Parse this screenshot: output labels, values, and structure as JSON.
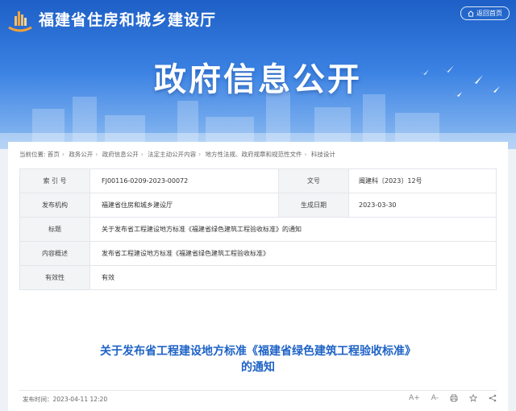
{
  "header": {
    "site_title": "福建省住房和城乡建设厅",
    "home_button": "返回首页",
    "banner_title": "政府信息公开"
  },
  "breadcrumb": {
    "label": "当前位置:",
    "items": [
      "首页",
      "政务公开",
      "政府信息公开",
      "法定主动公开内容",
      "地方性法规、政府规章和规范性文件",
      "科技设计"
    ]
  },
  "meta": {
    "index_label": "索 引 号",
    "index_value": "FJ00116-0209-2023-00072",
    "doc_no_label": "文号",
    "doc_no_value": "闽建科〔2023〕12号",
    "issuer_label": "发布机构",
    "issuer_value": "福建省住房和城乡建设厅",
    "date_label": "生成日期",
    "date_value": "2023-03-30",
    "title_label": "标题",
    "title_value": "关于发布省工程建设地方标准《福建省绿色建筑工程验收标准》的通知",
    "summary_label": "内容概述",
    "summary_value": "发布省工程建设地方标准《福建省绿色建筑工程验收标准》",
    "validity_label": "有效性",
    "validity_value": "有效"
  },
  "article": {
    "title_line1": "关于发布省工程建设地方标准《福建省绿色建筑工程验收标准》",
    "title_line2": "的通知",
    "pub_time_label": "发布时间：",
    "pub_time_value": "2023-04-11 12:20"
  },
  "tools": {
    "font_increase": "A+",
    "font_decrease": "A-"
  },
  "colors": {
    "banner_top": "#1d5fc6",
    "title_blue": "#1f63c6"
  }
}
